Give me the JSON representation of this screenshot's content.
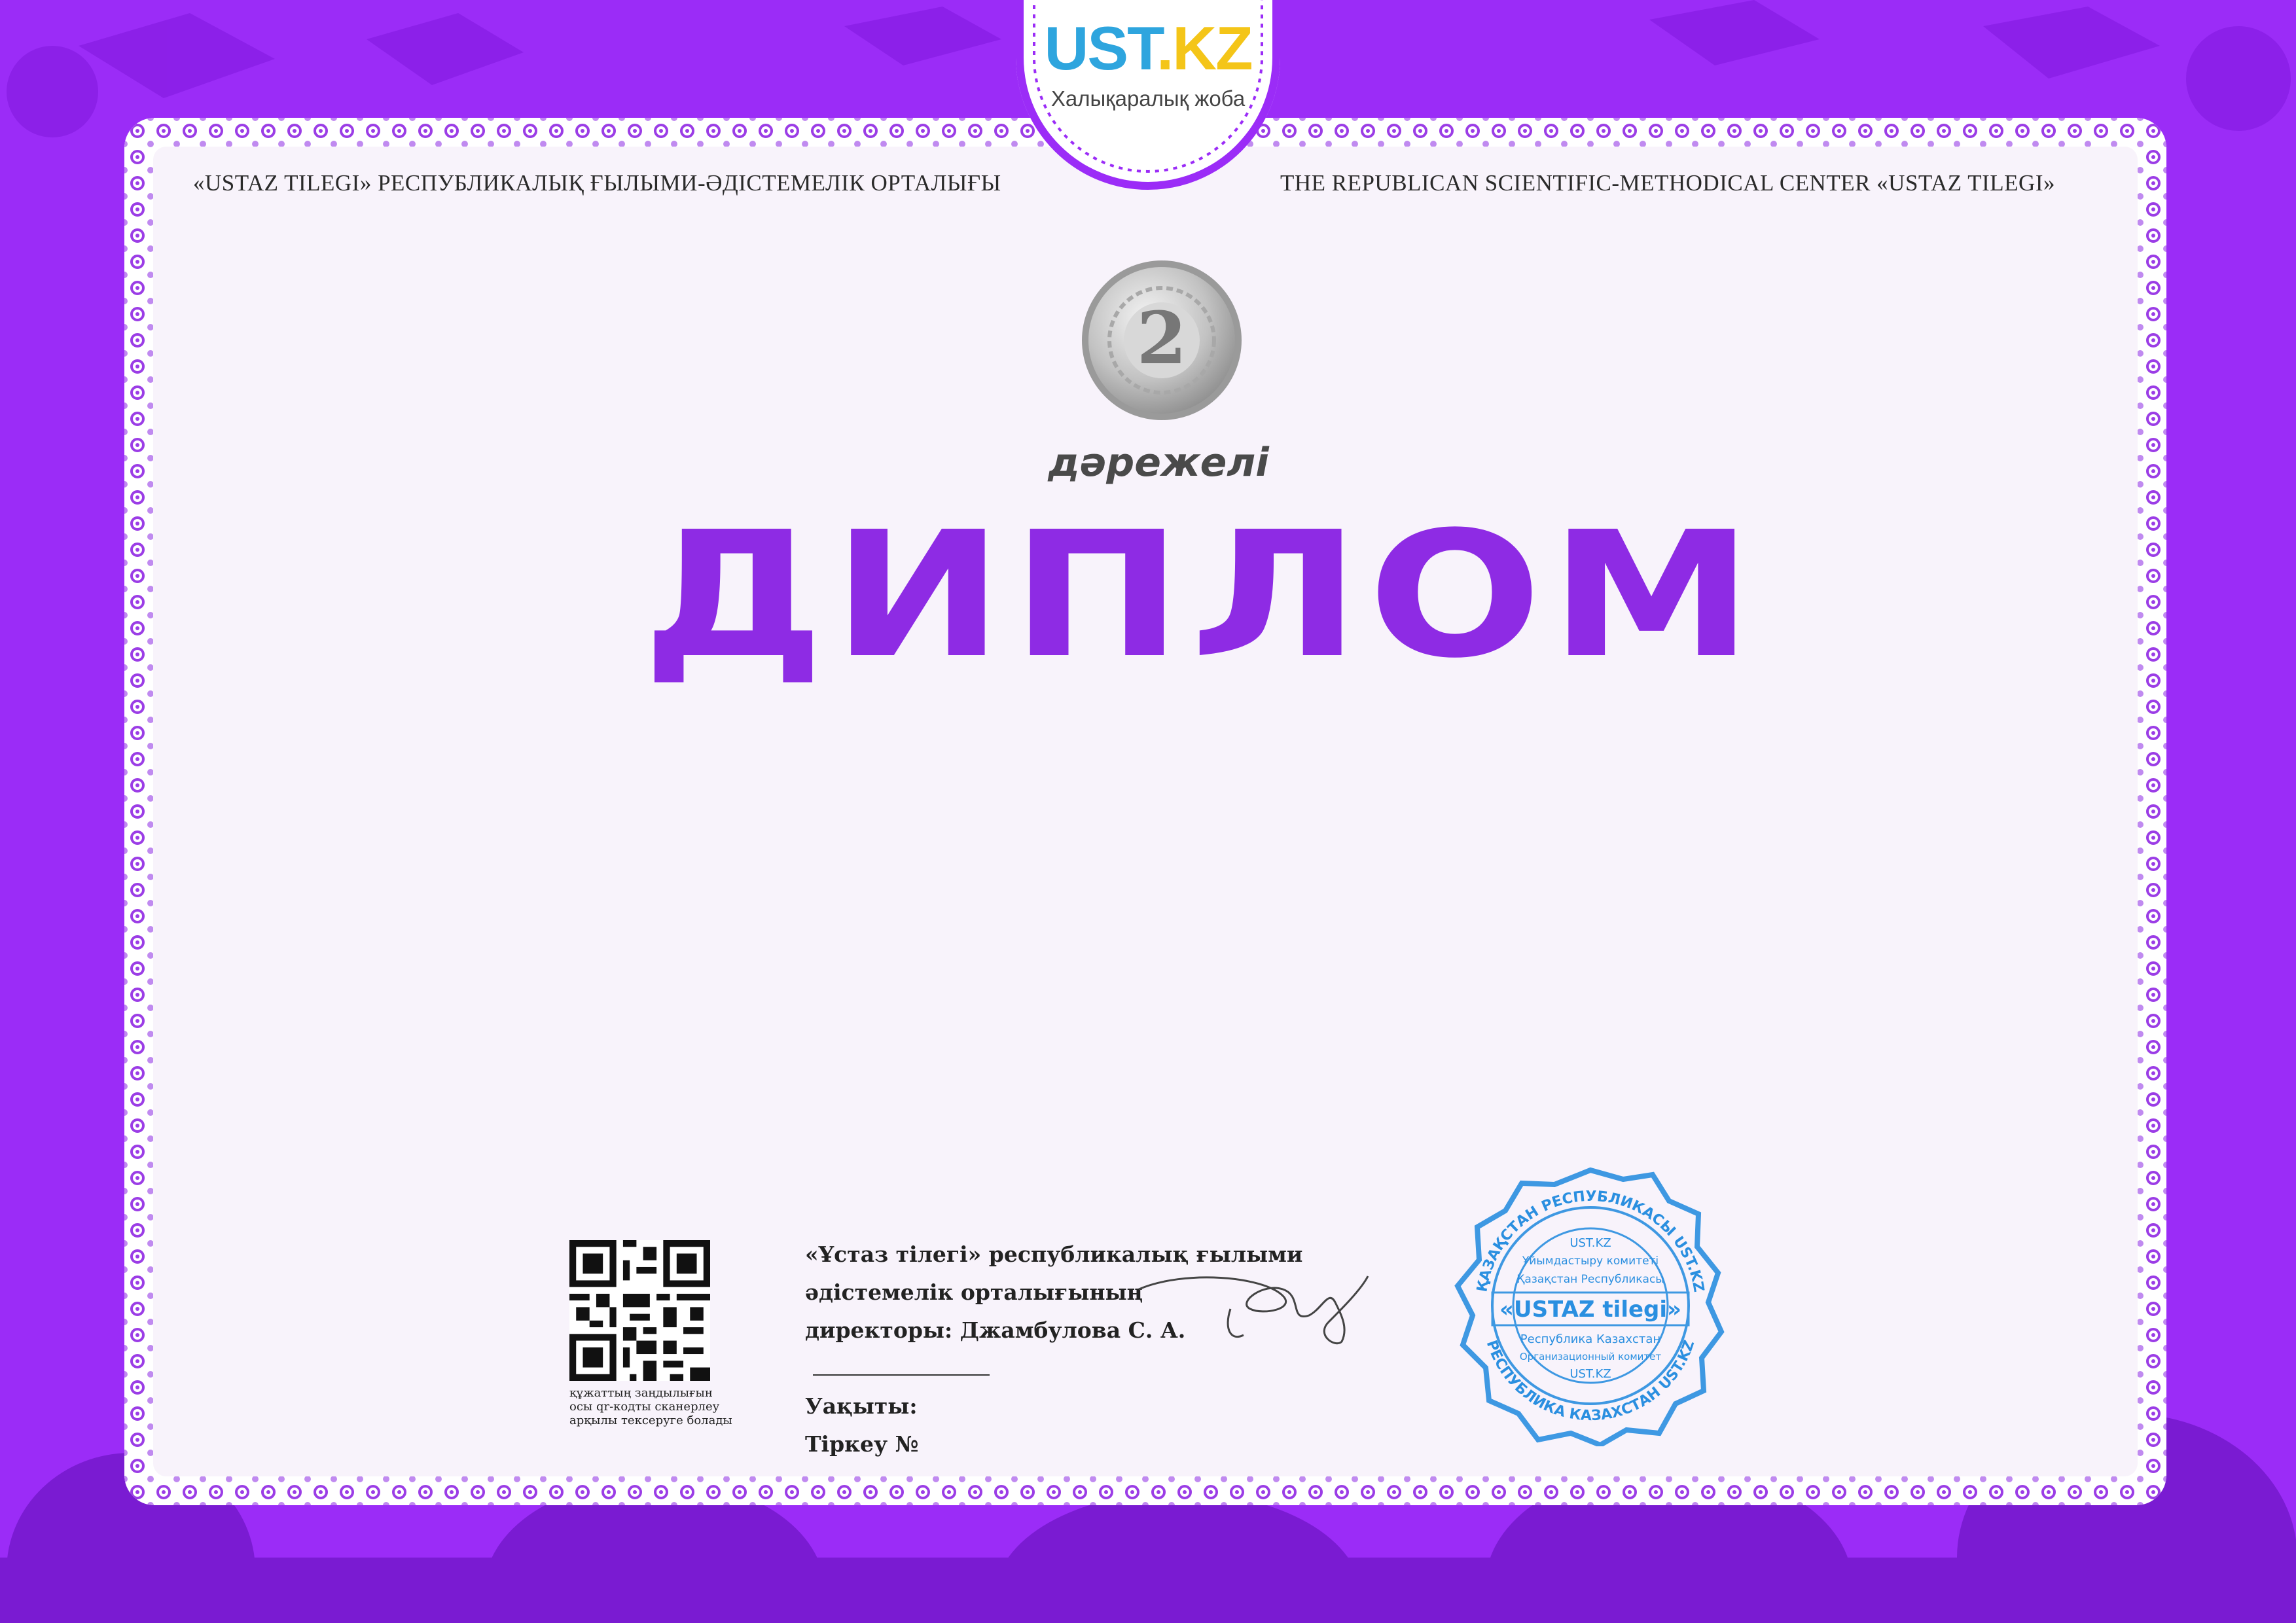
{
  "colors": {
    "background": "#9b2cf7",
    "accent": "#8e2be4",
    "stamp": "#2a8fe0"
  },
  "header": {
    "left": "«USTAZ TILEGI» РЕСПУБЛИКАЛЫҚ ҒЫЛЫМИ-ӘДІСТЕМЕЛІК ОРТАЛЫҒЫ",
    "right": "THE REPUBLICAN SCIENTIFIC-METHODICAL CENTER «USTAZ TILEGI»"
  },
  "logo": {
    "brand_a": "UST",
    "brand_b": ".KZ",
    "subtitle": "Халықаралық жоба"
  },
  "medal": {
    "number": "2"
  },
  "diploma": {
    "degree": "дәрежелі",
    "title": "ДИПЛОМ"
  },
  "qr": {
    "caption_1": "құжаттың заңдылығын",
    "caption_2": "осы qr-кодты сканерлеу",
    "caption_3": "арқылы тексеруге болады"
  },
  "signature": {
    "line_1": "«Ұстаз тілегі» республикалық ғылыми",
    "line_2": "әдістемелік орталығының",
    "line_3": "директоры: Джамбулова С. А.",
    "time_label": "Уақыты:",
    "reg_label": "Тіркеу №"
  },
  "stamp": {
    "outer_top": "ҚАЗАҚСТАН РЕСПУБЛИКАСЫ UST.KZ",
    "outer_bottom": "РЕСПУБЛИКА КАЗАХСТАН UST.KZ",
    "line_1": "UST.KZ",
    "line_2": "Ұйымдастыру комитеті",
    "line_3": "Қазақстан Республикасы",
    "center": "«USTAZ tilegi»",
    "line_4": "Республика Казахстан",
    "line_5": "Организационный комитет",
    "line_6": "UST.KZ"
  }
}
